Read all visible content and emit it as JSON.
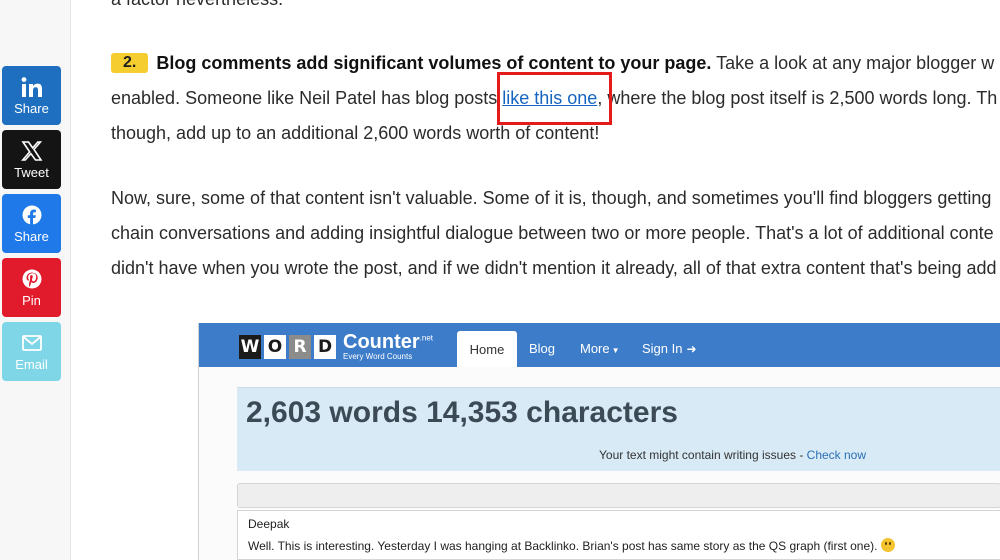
{
  "share": {
    "linkedin": {
      "label": "Share",
      "icon": "linkedin-icon"
    },
    "twitter": {
      "label": "Tweet",
      "icon": "x-icon"
    },
    "facebook": {
      "label": "Share",
      "icon": "facebook-icon"
    },
    "pinterest": {
      "label": "Pin",
      "icon": "pinterest-icon"
    },
    "email": {
      "label": "Email",
      "icon": "email-icon"
    }
  },
  "article": {
    "top_fragment": "a factor nevertheless.",
    "point": {
      "number": "2.",
      "heading": "Blog comments add significant volumes of content to your page.",
      "line1_rest": " Take a look at any major blogger w",
      "line2_before": "enabled. Someone like Neil Patel has blog posts ",
      "link_text": "like this one",
      "line2_after": ", where the blog post itself is 2,500 words long. Th",
      "line3": "though, add up to an additional 2,600 words worth of content!"
    },
    "para2": [
      "Now, sure, some of that content isn't valuable. Some of it is, though, and sometimes you'll find bloggers getting",
      "chain conversations and adding insightful dialogue between two or more people. That's a lot of additional conte",
      "didn't have when you wrote the post, and if we didn't mention it already, all of that extra content that's being add"
    ]
  },
  "wordcounter": {
    "logo_letters": [
      "W",
      "O",
      "R",
      "D"
    ],
    "brand": "Counter",
    "brand_tld": ".net",
    "tagline": "Every Word Counts",
    "nav": {
      "home": "Home",
      "blog": "Blog",
      "more": "More",
      "signin": "Sign In"
    },
    "count": "2,603 words 14,353 characters",
    "issue_text": "Your text might contain writing issues - ",
    "issue_link": "Check now",
    "comment_name": "Deepak",
    "comment_body": "Well. This is interesting. Yesterday I was hanging at Backlinko. Brian's post has same story as the QS graph (first one)."
  },
  "colors": {
    "linkedin": "#1e6fbf",
    "twitter": "#141414",
    "facebook": "#1f79e8",
    "pinterest": "#e21b2c",
    "email": "#7fd6e6",
    "highlight_box": "#e31b1b",
    "badge": "#f5cd2f",
    "link": "#1565c0",
    "wc_nav": "#3d7cc9",
    "wc_count_bg": "#d8eaf6"
  }
}
